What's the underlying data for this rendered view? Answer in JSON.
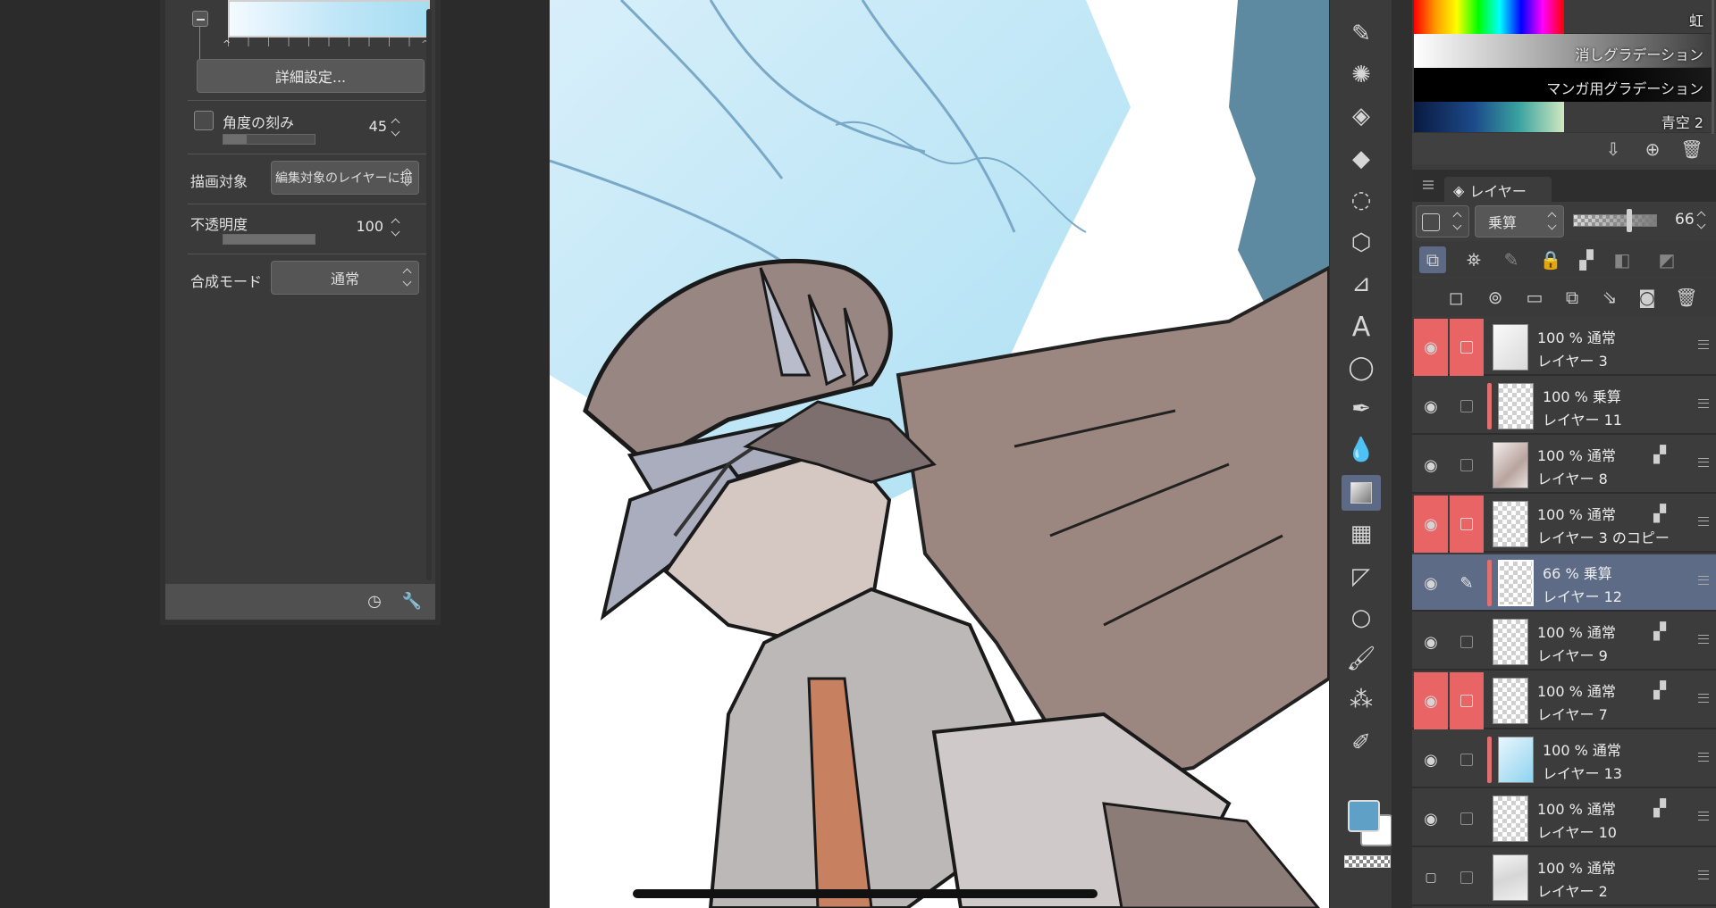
{
  "tool_property": {
    "detail_button": "詳細設定...",
    "angle_step_label": "角度の刻み",
    "angle_step_value": "45",
    "draw_target_label": "描画対象",
    "draw_target_value": "編集対象のレイヤーに描",
    "opacity_label": "不透明度",
    "opacity_value": "100",
    "blend_mode_label": "合成モード",
    "blend_mode_value": "通常",
    "gradient_colors": [
      "#f4faff",
      "#a5ddf2"
    ]
  },
  "gradient_sets": {
    "items": [
      {
        "name": "虹",
        "style": "linear-gradient(90deg,#ff0000,#ff9900,#ffff00,#00ff00,#00ffff,#0000ff,#ff00ff,#ff0000)",
        "width_pct": 50
      },
      {
        "name": "消しグラデーション",
        "style": "linear-gradient(90deg,#ffffff,#8a8a8a 60%,rgba(60,60,60,0))",
        "width_pct": 100
      },
      {
        "name": "マンガ用グラデーション",
        "style": "linear-gradient(90deg,#000000,#000000 60%,#1a1a1a)",
        "width_pct": 100
      },
      {
        "name": "青空 2",
        "style": "linear-gradient(90deg,#0a1a40,#1c4a8a 40%,#3aa3a0 70%,#cfe8c0)",
        "width_pct": 50
      }
    ]
  },
  "layer_panel": {
    "tab_label": "レイヤー",
    "blend_mode": "乗算",
    "opacity": "66",
    "layers": [
      {
        "line1": "100 % 通常",
        "line2": "レイヤー 3",
        "eye_red": true,
        "chk_red": true,
        "clip": false,
        "mask": false,
        "selected": false,
        "thumb": "sketch",
        "pen": false
      },
      {
        "line1": "100 % 乗算",
        "line2": "レイヤー 11",
        "eye_red": false,
        "chk_red": false,
        "clip": true,
        "mask": false,
        "selected": false,
        "thumb": "check",
        "pen": false
      },
      {
        "line1": "100 % 通常",
        "line2": "レイヤー 8",
        "eye_red": false,
        "chk_red": false,
        "clip": false,
        "mask": true,
        "selected": false,
        "thumb": "brown",
        "pen": false
      },
      {
        "line1": "100 % 通常",
        "line2": "レイヤー 3 のコピー",
        "eye_red": true,
        "chk_red": true,
        "clip": false,
        "mask": true,
        "selected": false,
        "thumb": "check",
        "pen": false
      },
      {
        "line1": "66 % 乗算",
        "line2": "レイヤー 12",
        "eye_red": false,
        "chk_red": false,
        "clip": true,
        "mask": false,
        "selected": true,
        "thumb": "check",
        "pen": true
      },
      {
        "line1": "100 % 通常",
        "line2": "レイヤー 9",
        "eye_red": false,
        "chk_red": false,
        "clip": false,
        "mask": true,
        "selected": false,
        "thumb": "check",
        "pen": false
      },
      {
        "line1": "100 % 通常",
        "line2": "レイヤー 7",
        "eye_red": true,
        "chk_red": true,
        "clip": false,
        "mask": true,
        "selected": false,
        "thumb": "check",
        "pen": false
      },
      {
        "line1": "100 % 通常",
        "line2": "レイヤー 13",
        "eye_red": false,
        "chk_red": false,
        "clip": true,
        "mask": false,
        "selected": false,
        "thumb": "blue",
        "pen": false
      },
      {
        "line1": "100 % 通常",
        "line2": "レイヤー 10",
        "eye_red": false,
        "chk_red": false,
        "clip": false,
        "mask": true,
        "selected": false,
        "thumb": "check",
        "pen": false
      },
      {
        "line1": "100 % 通常",
        "line2": "レイヤー 2",
        "eye_red": false,
        "chk_red": false,
        "clip": false,
        "mask": false,
        "selected": false,
        "thumb": "paper",
        "pen": false,
        "hidden": true
      }
    ]
  },
  "tools": [
    "pen-icon",
    "sparkle-brush-icon",
    "fill-bucket-icon",
    "eraser-icon",
    "lasso-icon",
    "3d-object-icon",
    "eyedropper-icon",
    "text-icon",
    "speech-balloon-icon",
    "pen-nib-icon",
    "blend-drops-icon",
    "gradient-icon",
    "frame-icon",
    "ruler-icon",
    "circle-icon",
    "brush-icon",
    "airbrush-icon",
    "fountain-pen-icon"
  ],
  "colors": {
    "main": "#5ea0c6",
    "sub": "#ffffff",
    "accent_red": "#e96565",
    "selected_row": "#5e6b87"
  }
}
